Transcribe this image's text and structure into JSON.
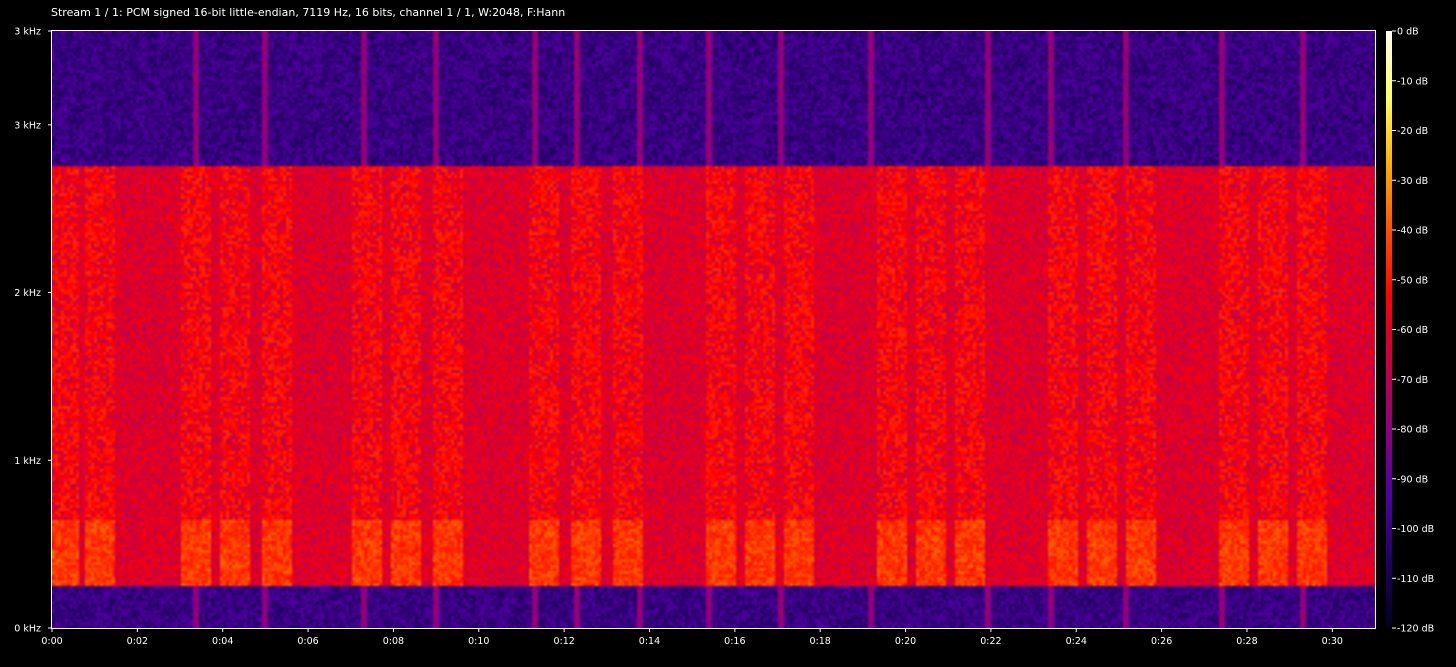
{
  "chart_data": {
    "type": "heatmap",
    "title": "Stream 1 / 1: PCM signed 16-bit little-endian, 7119 Hz, 16 bits, channel 1 / 1, W:2048, F:Hann",
    "xlabel": "",
    "ylabel": "",
    "x_ticks": [
      "0:00",
      "0:02",
      "0:04",
      "0:06",
      "0:08",
      "0:10",
      "0:12",
      "0:14",
      "0:16",
      "0:18",
      "0:20",
      "0:22",
      "0:24",
      "0:26",
      "0:28",
      "0:30"
    ],
    "x_tick_seconds": [
      0,
      2,
      4,
      6,
      8,
      10,
      12,
      14,
      16,
      18,
      20,
      22,
      24,
      26,
      28,
      30
    ],
    "xlim_seconds": [
      0,
      31
    ],
    "y_ticks": [
      "0 kHz",
      "1 kHz",
      "2 kHz",
      "3 kHz",
      "3 kHz"
    ],
    "y_tick_hz": [
      0,
      1000,
      2000,
      3000,
      3559.5
    ],
    "ylim_hz": [
      0,
      3559.5
    ],
    "colorbar_ticks": [
      "0 dB",
      "-10 dB",
      "-20 dB",
      "-30 dB",
      "-40 dB",
      "-50 dB",
      "-60 dB",
      "-70 dB",
      "-80 dB",
      "-90 dB",
      "-100 dB",
      "-110 dB",
      "-120 dB"
    ],
    "colorbar_db": [
      0,
      -10,
      -20,
      -30,
      -40,
      -50,
      -60,
      -70,
      -80,
      -90,
      -100,
      -110,
      -120
    ],
    "colormap_stops": [
      "#fffff0",
      "#ffff60",
      "#ffb000",
      "#ff5000",
      "#ff0000",
      "#c80040",
      "#900080",
      "#5000a0",
      "#200060",
      "#000020"
    ],
    "band_hz": [
      250,
      2750
    ],
    "background_db_in_band": -62,
    "background_db_out_band": -100,
    "speech_onsets_seconds": [
      0.1,
      0.95,
      3.2,
      4.1,
      5.1,
      7.2,
      8.1,
      9.1,
      11.3,
      12.3,
      13.3,
      15.5,
      16.4,
      17.3,
      19.5,
      20.4,
      21.3,
      23.5,
      24.4,
      25.3,
      27.5,
      28.4,
      29.3
    ],
    "vertical_lines_seconds": [
      3.4,
      5.0,
      7.3,
      9.0,
      11.3,
      12.3,
      13.8,
      15.4,
      17.1,
      19.2,
      21.9,
      23.4,
      25.2,
      27.4,
      29.3
    ]
  }
}
